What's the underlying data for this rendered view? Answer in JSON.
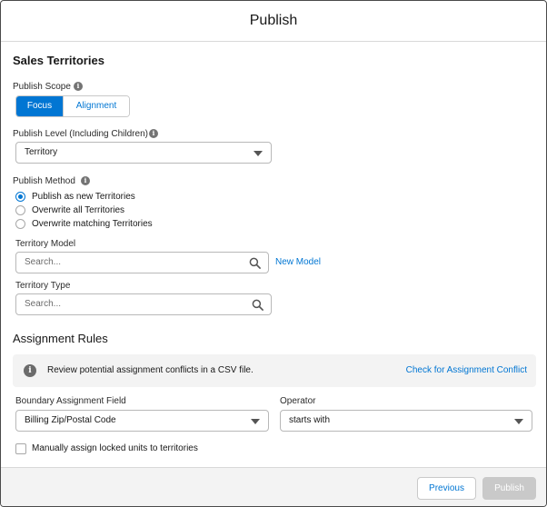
{
  "header": {
    "title": "Publish"
  },
  "sales_territories": {
    "title": "Sales Territories",
    "publish_scope": {
      "label": "Publish Scope",
      "options": [
        "Focus",
        "Alignment"
      ],
      "selected": "Focus"
    },
    "publish_level": {
      "label": "Publish Level (Including Children)",
      "value": "Territory"
    },
    "publish_method": {
      "label": "Publish Method",
      "options": [
        "Publish as new Territories",
        "Overwrite all Territories",
        "Overwrite matching Territories"
      ],
      "selected": "Publish as new Territories"
    },
    "territory_model": {
      "label": "Territory Model",
      "placeholder": "Search...",
      "new_link": "New Model"
    },
    "territory_type": {
      "label": "Territory Type",
      "placeholder": "Search..."
    }
  },
  "assignment_rules": {
    "title": "Assignment Rules",
    "banner": {
      "text": "Review potential assignment conflicts in a CSV file.",
      "link": "Check for Assignment Conflict"
    },
    "boundary_field": {
      "label": "Boundary Assignment Field",
      "value": "Billing Zip/Postal Code"
    },
    "operator": {
      "label": "Operator",
      "value": "starts with"
    },
    "manual_assign": {
      "label": "Manually assign locked units to territories",
      "checked": false
    }
  },
  "footer": {
    "previous_label": "Previous",
    "publish_label": "Publish"
  },
  "colors": {
    "brand": "#0176d3",
    "disabled": "#c9c9c9",
    "footer_bg": "#f3f3f3"
  },
  "icons": [
    "info-icon",
    "search-icon",
    "chevron-down-icon"
  ]
}
